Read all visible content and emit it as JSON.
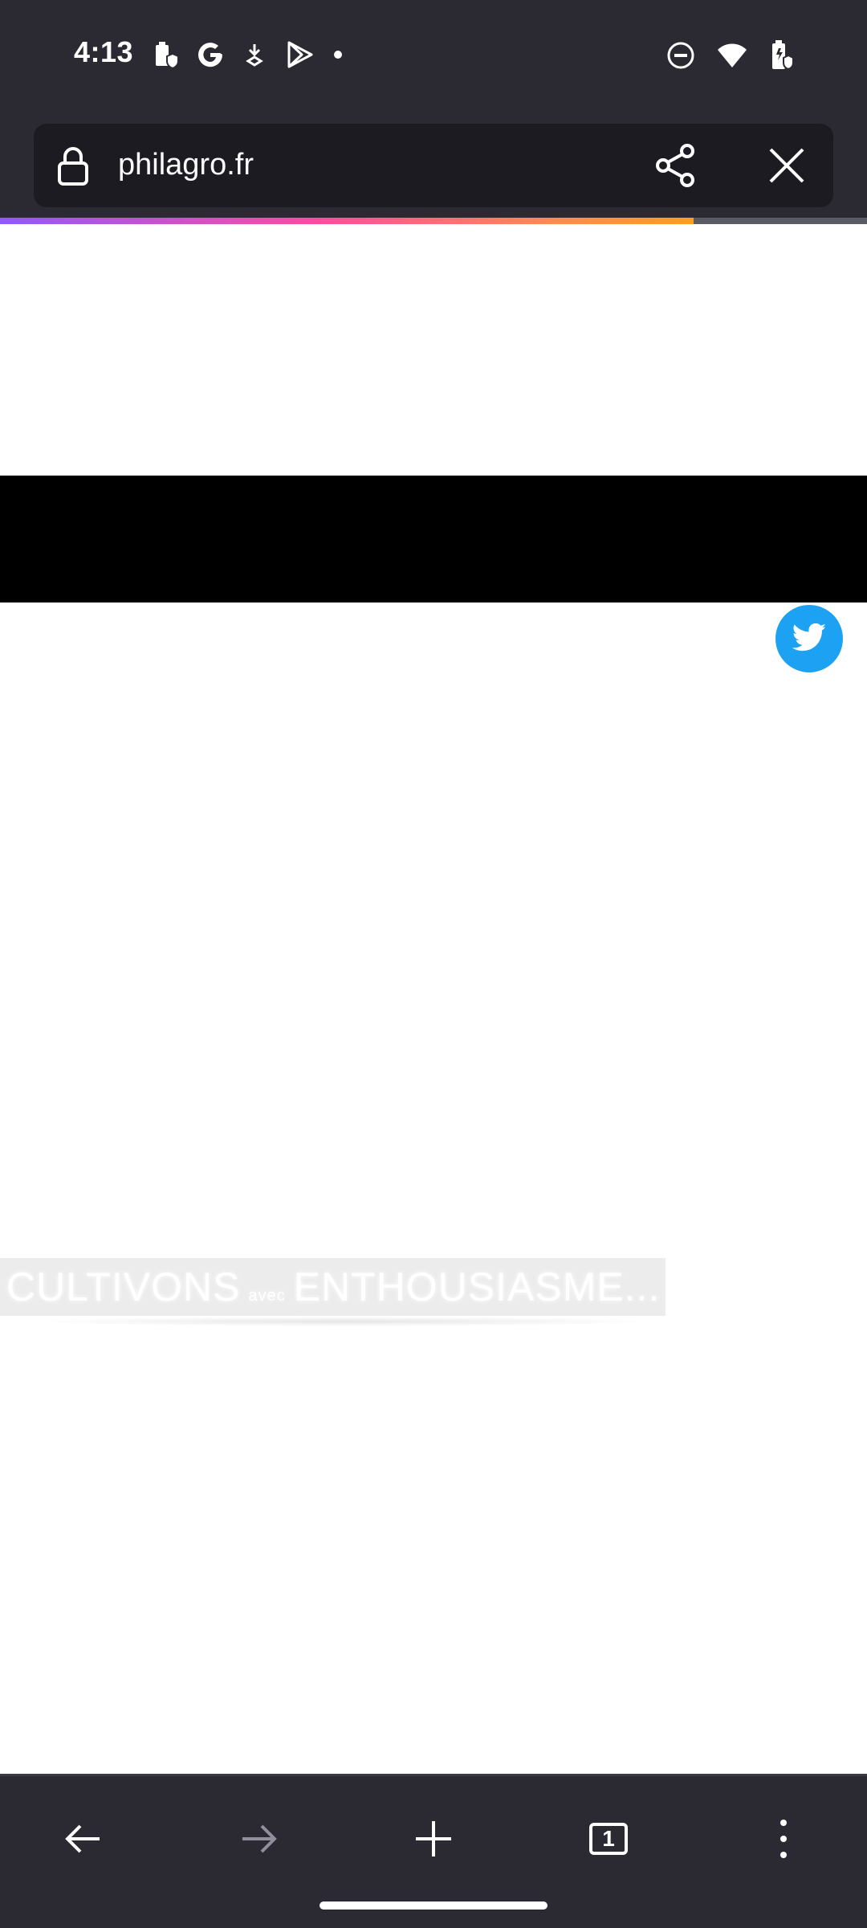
{
  "status_bar": {
    "time": "4:13",
    "left_icons": [
      "battery-saver-icon",
      "google-icon",
      "download-icon",
      "play-store-icon",
      "dot-icon"
    ],
    "right_icons": [
      "do-not-disturb-icon",
      "wifi-icon",
      "battery-icon"
    ]
  },
  "browser": {
    "url": "philagro.fr",
    "load_progress_percent": 80,
    "colors": {
      "toolbar_bg": "#2b2a33",
      "url_bg": "#1c1b22",
      "twitter_blue": "#1da1f2"
    }
  },
  "page": {
    "banner_text_1": "CULTIVONS",
    "banner_text_small": "avec",
    "banner_text_2": "ENTHOUSIASME..."
  },
  "bottom_bar": {
    "tab_count": "1"
  }
}
